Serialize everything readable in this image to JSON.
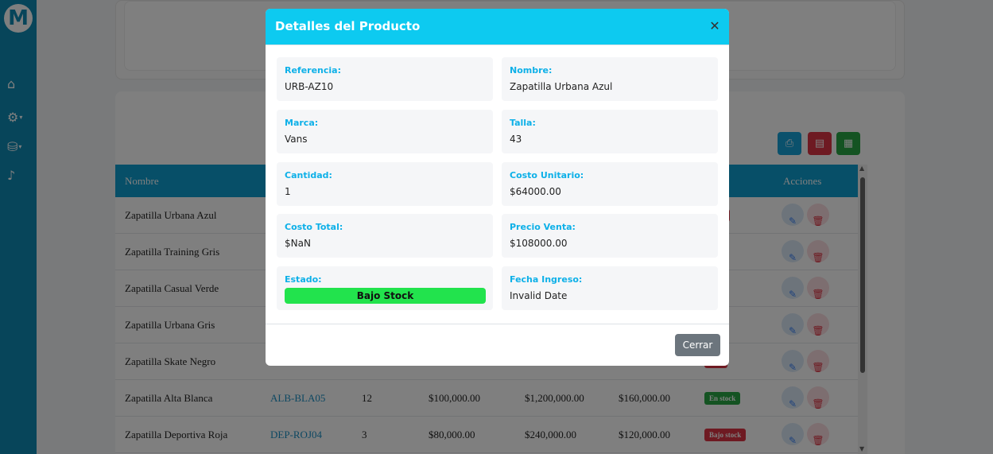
{
  "sidebar": {
    "logo_text": "M",
    "items": [
      {
        "icon": "home-icon",
        "glyph": "⌂"
      },
      {
        "icon": "gear-icon",
        "glyph": "⚙"
      },
      {
        "icon": "database-icon",
        "glyph": "⛁"
      },
      {
        "icon": "bell-icon",
        "glyph": "♪"
      }
    ]
  },
  "table": {
    "headers": [
      "Nombre",
      "Acciones"
    ],
    "rows": [
      {
        "nombre": "Zapatilla Urbana Azul",
        "ref": "",
        "cantidad": "",
        "costo": "",
        "total": "",
        "precio": "",
        "estado": "stock",
        "estado_color": "#dc3545"
      },
      {
        "nombre": "Zapatilla Training Gris",
        "ref": "",
        "cantidad": "",
        "costo": "",
        "total": "",
        "precio": "",
        "estado": "tock",
        "estado_color": "#dc3545"
      },
      {
        "nombre": "Zapatilla Casual Verde",
        "ref": "",
        "cantidad": "",
        "costo": "",
        "total": "",
        "precio": "",
        "estado": "tock",
        "estado_color": "#dc3545"
      },
      {
        "nombre": "Zapatilla Urbana Gris",
        "ref": "",
        "cantidad": "",
        "costo": "",
        "total": "",
        "precio": "",
        "estado": "tock",
        "estado_color": "#dc3545"
      },
      {
        "nombre": "Zapatilla Skate Negro",
        "ref": "",
        "cantidad": "",
        "costo": "",
        "total": "",
        "precio": "",
        "estado": "tock",
        "estado_color": "#dc3545"
      },
      {
        "nombre": "Zapatilla Alta Blanca",
        "ref": "ALB-BLA05",
        "cantidad": "12",
        "costo": "$100,000.00",
        "total": "$1,200,000.00",
        "precio": "$160,000.00",
        "estado": "En stock",
        "estado_color": "#28a745"
      },
      {
        "nombre": "Zapatilla Deportiva Roja",
        "ref": "DEP-ROJ04",
        "cantidad": "3",
        "costo": "$80,000.00",
        "total": "$240,000.00",
        "precio": "$120,000.00",
        "estado": "Bajo stock",
        "estado_color": "#dc3545"
      }
    ]
  },
  "modal": {
    "title": "Detalles del Producto",
    "close_glyph": "✕",
    "fields": [
      {
        "label": "Referencia:",
        "value": "URB-AZ10"
      },
      {
        "label": "Nombre:",
        "value": "Zapatilla Urbana Azul"
      },
      {
        "label": "Marca:",
        "value": "Vans"
      },
      {
        "label": "Talla:",
        "value": "43"
      },
      {
        "label": "Cantidad:",
        "value": "1"
      },
      {
        "label": "Costo Unitario:",
        "value": "$64000.00"
      },
      {
        "label": "Costo Total:",
        "value": "$NaN"
      },
      {
        "label": "Precio Venta:",
        "value": "$108000.00"
      },
      {
        "label": "Estado:",
        "value": "Bajo Stock"
      },
      {
        "label": "Fecha Ingreso:",
        "value": "Invalid Date"
      }
    ],
    "close_button": "Cerrar"
  },
  "colors": {
    "sidebar": "#0e8bb5",
    "modal_header": "#0dcaf0",
    "status_green": "#22e34d",
    "label_cyan": "#0db0e8"
  }
}
